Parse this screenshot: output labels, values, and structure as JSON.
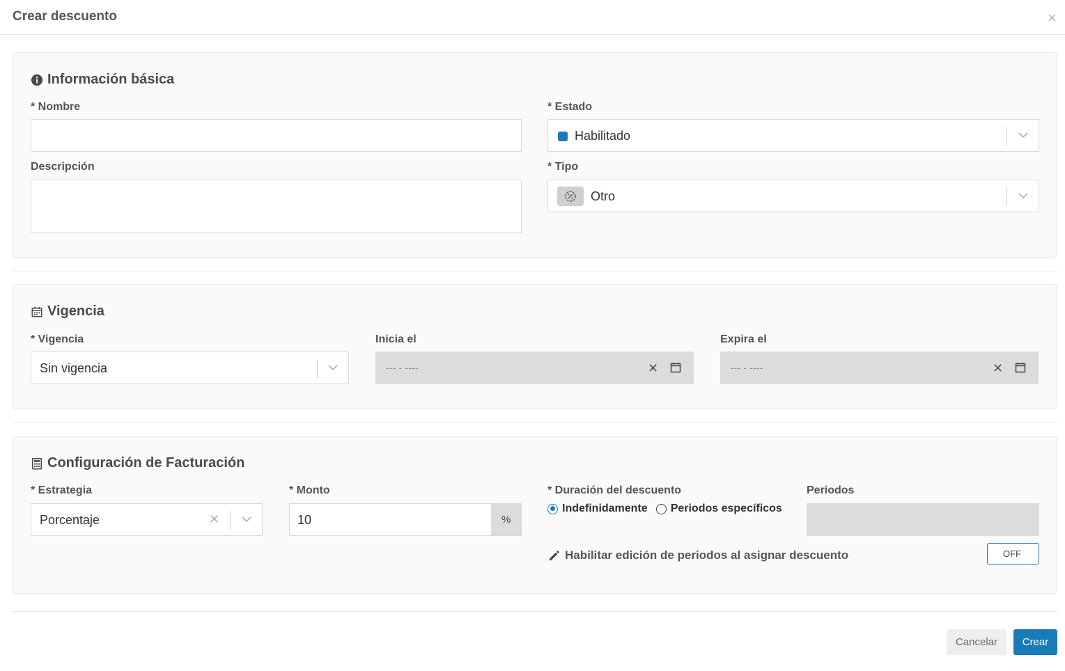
{
  "modal": {
    "title": "Crear descuento",
    "close_label": "×"
  },
  "basic": {
    "title": "Información básica",
    "nombre_label": "* Nombre",
    "nombre_value": "",
    "descripcion_label": "Descripción",
    "descripcion_value": "",
    "estado_label": "* Estado",
    "estado_value": "Habilitado",
    "estado_color": "#1a7bb9",
    "tipo_label": "* Tipo",
    "tipo_value": "Otro"
  },
  "vigencia": {
    "title": "Vigencia",
    "vigencia_label": "* Vigencia",
    "vigencia_value": "Sin vigencia",
    "inicia_label": "Inicia el",
    "inicia_placeholder": "--- - ----",
    "expira_label": "Expira el",
    "expira_placeholder": "--- - ----"
  },
  "billing": {
    "title": "Configuración de Facturación",
    "estrategia_label": "* Estrategia",
    "estrategia_value": "Porcentaje",
    "monto_label": "* Monto",
    "monto_value": "10",
    "monto_unit": "%",
    "duracion_label": "* Duración del descuento",
    "duracion_options": [
      "Indefinidamente",
      "Periodos específicos"
    ],
    "duracion_selected": "Indefinidamente",
    "periodos_label": "Periodos",
    "periodos_value": "",
    "edit_label": "Habilitar edición de periodos al asignar descuento",
    "toggle_state": "OFF"
  },
  "footer": {
    "cancel_label": "Cancelar",
    "create_label": "Crear"
  },
  "colors": {
    "primary": "#1a7bb9"
  }
}
